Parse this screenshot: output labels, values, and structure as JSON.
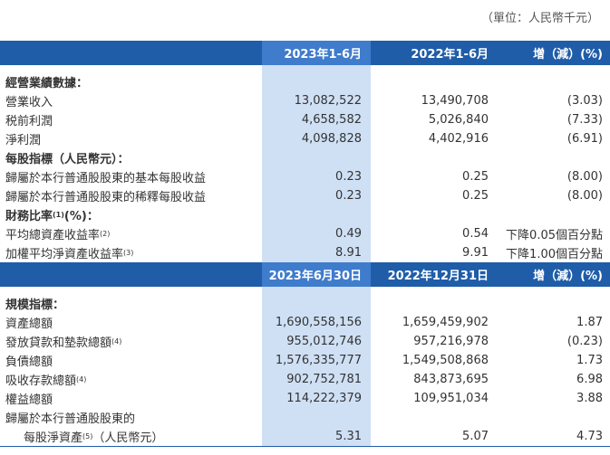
{
  "unit_note": "（單位：人民幣千元）",
  "header1": {
    "col1": "2023年1-6月",
    "col2": "2022年1-6月",
    "col3": "增（減）(%)"
  },
  "sec_operating": "經營業績數據：",
  "operating": [
    {
      "label": "營業收入",
      "v1": "13,082,522",
      "v2": "13,490,708",
      "v3": "(3.03)"
    },
    {
      "label": "税前利潤",
      "v1": "4,658,582",
      "v2": "5,026,840",
      "v3": "(7.33)"
    },
    {
      "label": "淨利潤",
      "v1": "4,098,828",
      "v2": "4,402,916",
      "v3": "(6.91)"
    }
  ],
  "sec_per_share": "每股指標（人民幣元）：",
  "per_share": [
    {
      "label": "歸屬於本行普通股股東的基本每股收益",
      "v1": "0.23",
      "v2": "0.25",
      "v3": "(8.00)"
    },
    {
      "label": "歸屬於本行普通股股東的稀釋每股收益",
      "v1": "0.23",
      "v2": "0.25",
      "v3": "(8.00)"
    }
  ],
  "sec_ratio": "財務比率",
  "sec_ratio_sup": "(1)",
  "sec_ratio_suffix": "(%)：",
  "ratios": [
    {
      "label": "平均總資產收益率",
      "sup": "(2)",
      "v1": "0.49",
      "v2": "0.54",
      "v3": "下降0.05個百分點"
    },
    {
      "label": "加權平均淨資產收益率",
      "sup": "(3)",
      "v1": "8.91",
      "v2": "9.91",
      "v3": "下降1.00個百分點"
    }
  ],
  "header2": {
    "col1": "2023年6月30日",
    "col2": "2022年12月31日",
    "col3": "增（減）(%)"
  },
  "sec_scale": "規模指標：",
  "scale": [
    {
      "label": "資產總額",
      "sup": "",
      "v1": "1,690,558,156",
      "v2": "1,659,459,902",
      "v3": "1.87"
    },
    {
      "label": "發放貸款和墊款總額",
      "sup": "(4)",
      "v1": "955,012,746",
      "v2": "957,216,978",
      "v3": "(0.23)"
    },
    {
      "label": "負債總額",
      "sup": "",
      "v1": "1,576,335,777",
      "v2": "1,549,508,868",
      "v3": "1.73"
    },
    {
      "label": "吸收存款總額",
      "sup": "(4)",
      "v1": "902,752,781",
      "v2": "843,873,695",
      "v3": "6.98"
    },
    {
      "label": "權益總額",
      "sup": "",
      "v1": "114,222,379",
      "v2": "109,951,034",
      "v3": "3.88"
    }
  ],
  "nav_line1": "歸屬於本行普通股股東的",
  "nav": {
    "label": "每股淨資產",
    "sup": "(5)",
    "suffix": "（人民幣元）",
    "v1": "5.31",
    "v2": "5.07",
    "v3": "4.73"
  }
}
